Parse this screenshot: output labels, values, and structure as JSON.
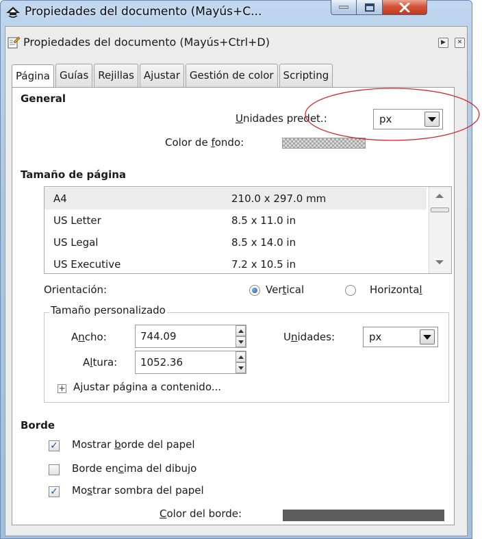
{
  "window": {
    "title": "Propiedades del documento (Mayús+C..."
  },
  "dock": {
    "title": "Propiedades del documento (Mayús+Ctrl+D)"
  },
  "tabs": [
    {
      "label": "Página",
      "active": true
    },
    {
      "label": "Guías"
    },
    {
      "label": "Rejillas"
    },
    {
      "label": "Ajustar"
    },
    {
      "label": "Gestión de color"
    },
    {
      "label": "Scripting"
    }
  ],
  "general": {
    "title": "General",
    "units_label_pre": "",
    "units_label_acc": "U",
    "units_label_post": "nidades predet.:",
    "units_value": "px",
    "bg_label_pre": "Color de ",
    "bg_label_acc": "f",
    "bg_label_post": "ondo:"
  },
  "page_size": {
    "title": "Tamaño de página",
    "rows": [
      {
        "name": "A4",
        "size": "210.0 x 297.0 mm"
      },
      {
        "name": "US Letter",
        "size": "8.5 x 11.0 in"
      },
      {
        "name": "US Legal",
        "size": "8.5 x 14.0 in"
      },
      {
        "name": "US Executive",
        "size": "7.2 x 10.5 in"
      }
    ],
    "orientation_label": "Orientación:",
    "vertical_pre": "Ver",
    "vertical_acc": "t",
    "vertical_post": "ical",
    "horizontal_pre": "Horizonta",
    "horizontal_acc": "l",
    "horizontal_post": ""
  },
  "custom_size": {
    "legend": "Tamaño personalizado",
    "width_pre": "A",
    "width_acc": "n",
    "width_post": "cho:",
    "width_value": "744.09",
    "height_pre": "A",
    "height_acc": "l",
    "height_post": "tura:",
    "height_value": "1052.36",
    "units_pre": "U",
    "units_acc": "n",
    "units_post": "idades:",
    "units_value": "px",
    "fit_label": "Ajustar página a contenido..."
  },
  "border": {
    "title": "Borde",
    "show_border_pre": "Mostrar ",
    "show_border_acc": "b",
    "show_border_post": "orde del papel",
    "show_border_checked": true,
    "on_top_pre": "Borde en",
    "on_top_acc": "c",
    "on_top_post": "ima del dibujo",
    "on_top_checked": false,
    "shadow_pre": "Mo",
    "shadow_acc": "s",
    "shadow_post": "trar sombra del papel",
    "shadow_checked": true,
    "color_pre": "",
    "color_acc": "C",
    "color_post": "olor del borde:",
    "color_value": "#5d5d5d"
  },
  "colors": {
    "annotation": "#d6262b",
    "close_button": "#c8412a"
  }
}
